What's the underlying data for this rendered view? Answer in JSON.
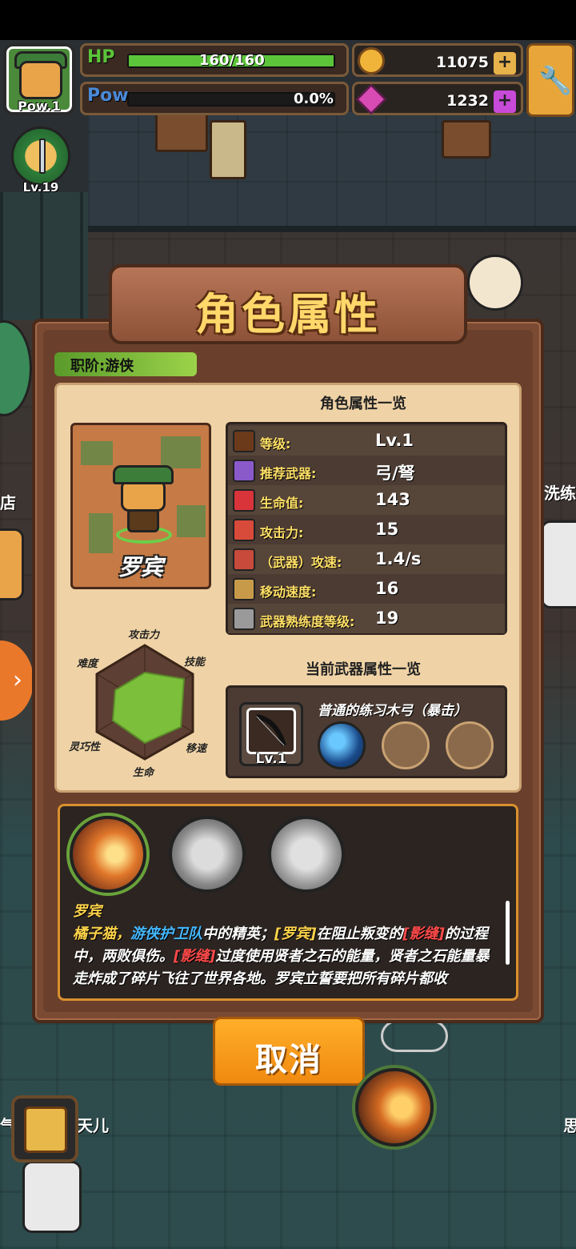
{
  "hud": {
    "avatar_pow": "Pow.1",
    "hp_label": "HP",
    "hp_value": "160/160",
    "hp_fraction": 1.0,
    "pow_label": "Pow",
    "pow_value": "0.0%",
    "pow_fraction": 0.0,
    "gold": "11075",
    "gems": "1232",
    "plus": "+",
    "weapon_level": "Lv.19"
  },
  "background": {
    "side_left_1": "店",
    "side_right_1": "洗练",
    "bottom_left": "气",
    "bottom_center_left": "天儿",
    "bottom_right": "思"
  },
  "modal": {
    "title": "角色属性",
    "class_tag": "职阶:游侠",
    "stats_title": "角色属性一览",
    "character_name": "罗宾",
    "stats": [
      {
        "label": "等级:",
        "value": "Lv.1",
        "icon": "level-icon",
        "color": "#6b3a1a"
      },
      {
        "label": "推荐武器:",
        "value": "弓/弩",
        "icon": "weapon-recommend-icon",
        "color": "#8a5acb"
      },
      {
        "label": "生命值:",
        "value": "143",
        "icon": "heart-icon",
        "color": "#d8343a"
      },
      {
        "label": "攻击力:",
        "value": "15",
        "icon": "attack-icon",
        "color": "#d84a3a"
      },
      {
        "label": "（武器）攻速:",
        "value": "1.4/s",
        "icon": "attack-speed-icon",
        "color": "#c84a3a"
      },
      {
        "label": "移动速度:",
        "value": "16",
        "icon": "boot-icon",
        "color": "#c79a4a"
      },
      {
        "label": "武器熟练度等级:",
        "value": "19",
        "icon": "mastery-icon",
        "color": "#9a9a9a"
      }
    ],
    "radar_labels": {
      "attack": "攻击力",
      "skill": "技能",
      "speed": "移速",
      "life": "生命",
      "agility": "灵巧性",
      "difficulty": "难度"
    },
    "weapon_title": "当前武器属性一览",
    "weapon_name": "普通的练习木弓（暴击）",
    "weapon_level": "Lv.1",
    "skill": {
      "name": "罗宾",
      "seg1": "橘子猫，",
      "seg2": "游侠护卫队",
      "seg3": "中的精英；",
      "seg4": "[罗宾]",
      "seg5": "在阻止叛变的",
      "seg6": "[影缝]",
      "seg7": "的过程中，两败俱伤。",
      "seg8": "[影缝]",
      "seg9": "过度使用贤者之石的能量，贤者之石能量暴走炸成了碎片飞往了世界各地。罗宾立誓要把所有碎片都收"
    },
    "cancel_label": "取消"
  },
  "colors": {
    "accent_orange": "#f08a10",
    "hp_green": "#5bc43a",
    "pow_blue": "#3a5ab4",
    "panel_bg": "#efd3a6",
    "stat_label_yellow": "#ffe066"
  }
}
